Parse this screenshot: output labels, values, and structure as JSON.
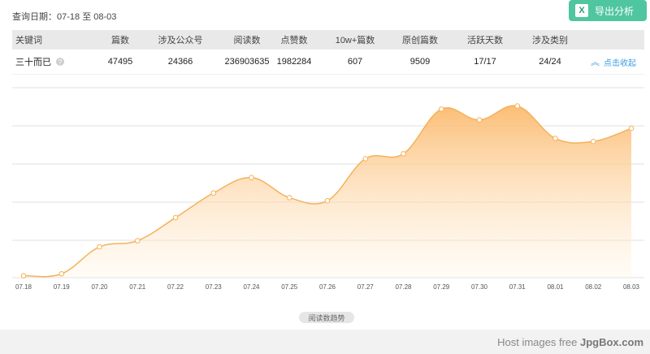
{
  "query": {
    "label": "查询日期：",
    "range": "07-18 至 08-03"
  },
  "export_button": {
    "label": "导出分析",
    "icon": "excel-icon"
  },
  "table": {
    "headers": [
      "关键词",
      "篇数",
      "涉及公众号",
      "阅读数",
      "点赞数",
      "10w+篇数",
      "原创篇数",
      "活跃天数",
      "涉及类别"
    ],
    "row": {
      "keyword": "三十而已",
      "values": [
        "47495",
        "24366",
        "236903635",
        "1982284",
        "607",
        "9509",
        "17/17",
        "24/24"
      ],
      "collapse_label": "点击收起"
    }
  },
  "chart_data": {
    "type": "area",
    "categories": [
      "07.18",
      "07.19",
      "07.20",
      "07.21",
      "07.22",
      "07.23",
      "07.24",
      "07.25",
      "07.26",
      "07.27",
      "07.28",
      "07.29",
      "07.30",
      "07.31",
      "08.01",
      "08.02",
      "08.03"
    ],
    "values": [
      0.5,
      1.0,
      8.0,
      9.6,
      15.6,
      22.0,
      26.0,
      20.8,
      20.0,
      30.9,
      32.2,
      43.8,
      41.0,
      44.6,
      36.2,
      35.4,
      38.8
    ],
    "ylim": [
      0,
      50
    ],
    "grid": true,
    "colors": {
      "line": "#f5b15a",
      "fill_top": "#fbb666",
      "fill_bottom": "#fff3e0",
      "grid": "#e2e2e2"
    }
  },
  "trend_label": "阅读数趋势",
  "watermark": {
    "prefix": "Host images free ",
    "brand": "JpgBox.com"
  }
}
